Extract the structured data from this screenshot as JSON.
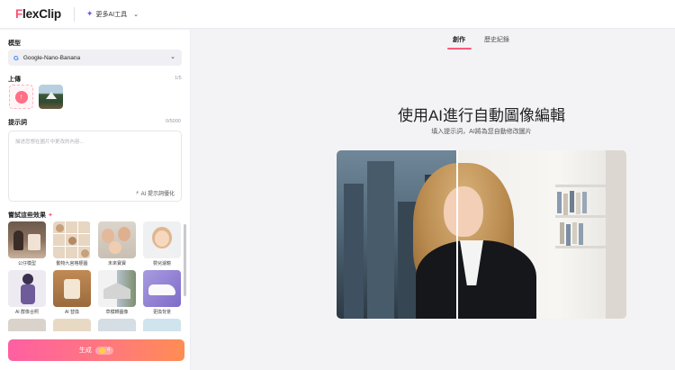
{
  "header": {
    "logo_prefix": "F",
    "logo_rest": "lexClip",
    "ai_tools_label": "更多AI工具"
  },
  "left": {
    "model_label": "模型",
    "model_value": "Google-Nano-Banana",
    "upload_label": "上傳",
    "upload_count": "1/5",
    "prompt_label": "提示詞",
    "prompt_count": "0/5000",
    "prompt_placeholder": "描述您想在圖片中更改的內容...",
    "optimize_label": "AI 提示詞優化",
    "try_label": "嘗試這些效果",
    "effects": [
      {
        "label": "公仔模型"
      },
      {
        "label": "動物九宮格梗圖"
      },
      {
        "label": "未來寶寶"
      },
      {
        "label": "嬰兒濾鏡"
      },
      {
        "label": "AI 群像合照"
      },
      {
        "label": "AI 替換"
      },
      {
        "label": "草模轉圖像"
      },
      {
        "label": "更換背景"
      }
    ],
    "generate_label": "生成",
    "generate_cost": "4"
  },
  "right": {
    "tabs": [
      {
        "label": "創作",
        "active": true
      },
      {
        "label": "歷史紀錄",
        "active": false
      }
    ],
    "headline": "使用AI進行自動圖像編輯",
    "subline": "填入提示詞，AI將為您自動修改圖片"
  },
  "colors": {
    "accent": "#ff5a7a",
    "generate_gradient_start": "#ff5fa2",
    "generate_gradient_end": "#ff8d52"
  }
}
